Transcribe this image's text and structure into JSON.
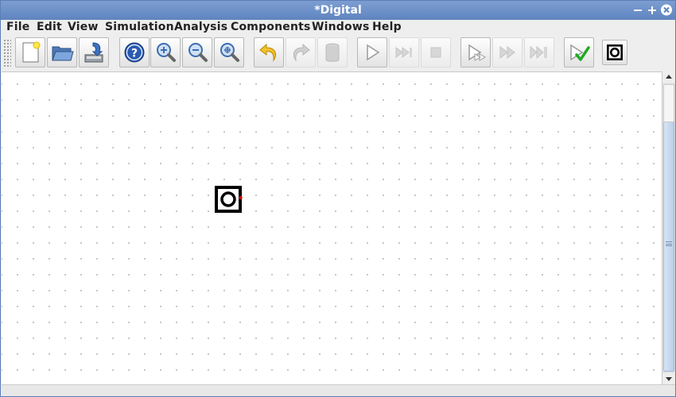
{
  "window": {
    "title": "*Digital",
    "controls": {
      "minimize": "−",
      "maximize": "+",
      "close": "×"
    }
  },
  "menu": {
    "items": [
      {
        "id": "file",
        "label": "File"
      },
      {
        "id": "edit",
        "label": "Edit"
      },
      {
        "id": "view",
        "label": "View"
      },
      {
        "id": "simulation",
        "label": "Simulation"
      },
      {
        "id": "analysis",
        "label": "Analysis"
      },
      {
        "id": "components",
        "label": "Components"
      },
      {
        "id": "windows",
        "label": "Windows"
      },
      {
        "id": "help",
        "label": "Help"
      }
    ]
  },
  "toolbar": {
    "buttons": [
      {
        "id": "new",
        "icon": "new-file-icon",
        "enabled": true
      },
      {
        "id": "open",
        "icon": "open-folder-icon",
        "enabled": true
      },
      {
        "id": "save",
        "icon": "save-icon",
        "enabled": true
      },
      {
        "id": "help",
        "icon": "help-icon",
        "enabled": true
      },
      {
        "id": "zoom-in",
        "icon": "zoom-in-icon",
        "enabled": true
      },
      {
        "id": "zoom-out",
        "icon": "zoom-out-icon",
        "enabled": true
      },
      {
        "id": "zoom-fit",
        "icon": "zoom-fit-icon",
        "enabled": true
      },
      {
        "id": "undo",
        "icon": "undo-icon",
        "enabled": true
      },
      {
        "id": "redo",
        "icon": "redo-icon",
        "enabled": false
      },
      {
        "id": "delete",
        "icon": "delete-icon",
        "enabled": false
      },
      {
        "id": "start",
        "icon": "play-icon",
        "enabled": true
      },
      {
        "id": "step",
        "icon": "step-forward-icon",
        "enabled": false
      },
      {
        "id": "stop",
        "icon": "stop-icon",
        "enabled": false
      },
      {
        "id": "run-to-break",
        "icon": "run-to-break-icon",
        "enabled": true
      },
      {
        "id": "fast-forward",
        "icon": "fast-forward-icon",
        "enabled": false
      },
      {
        "id": "skip-end",
        "icon": "skip-end-icon",
        "enabled": false
      },
      {
        "id": "test",
        "icon": "test-check-icon",
        "enabled": true
      },
      {
        "id": "component-shortcut",
        "icon": "component-shortcut-icon",
        "enabled": true
      }
    ]
  },
  "canvas": {
    "components": [
      {
        "id": "io-element",
        "icon": "io-component-icon",
        "pin_color": "#cc0000"
      }
    ]
  },
  "colors": {
    "titlebar": "#6a8fc8",
    "accent_red": "#cc0000",
    "check_green": "#22aa22"
  }
}
